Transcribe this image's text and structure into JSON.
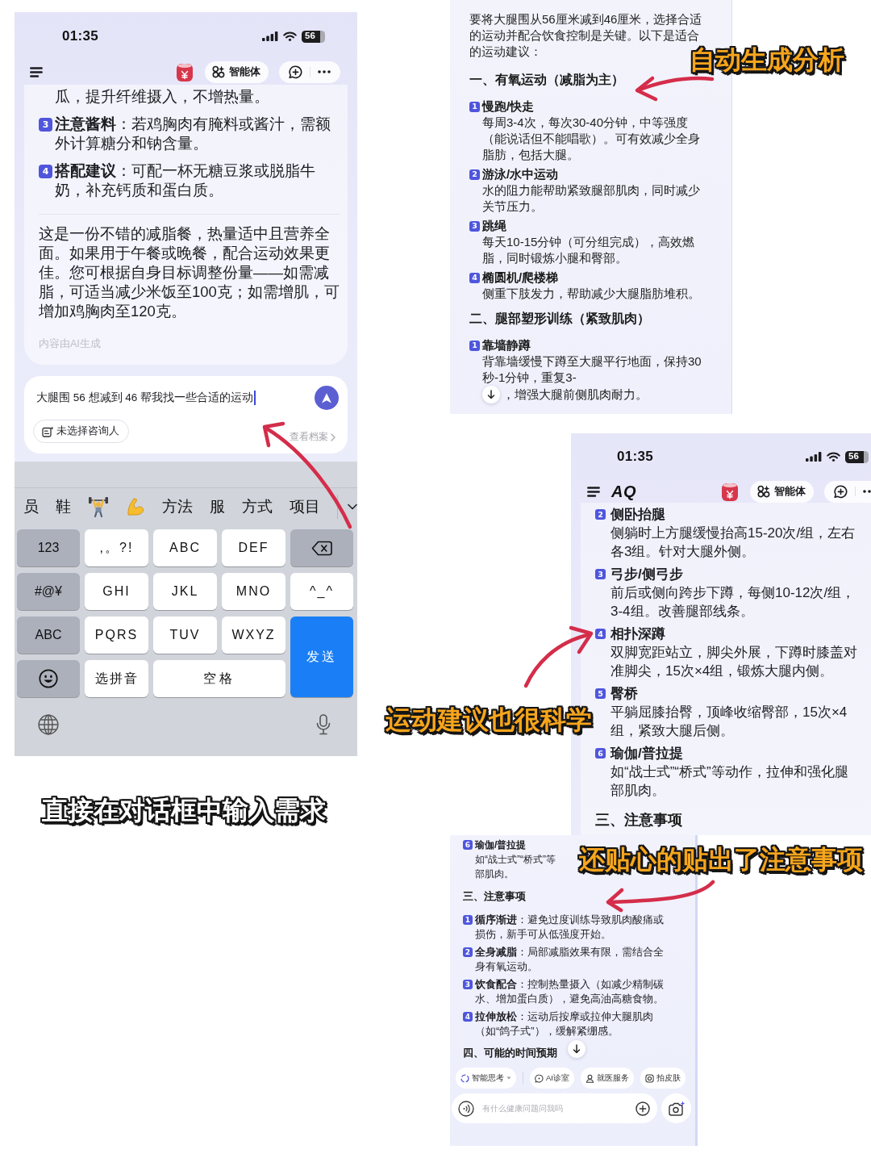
{
  "chat_screen": {
    "status_bar": {
      "time": "01:35",
      "battery": "56"
    },
    "header": {
      "agent_button": "智能体"
    },
    "reply": {
      "continuation": "瓜，提升纤维摄入，不增热量。",
      "items": [
        {
          "number": "3",
          "text": "**注意酱料**：若鸡胸肉有腌料或酱汁，需额外计算糖分和钠含量。"
        },
        {
          "number": "4",
          "text": "**搭配建议**：可配一杯无糖豆浆或脱脂牛奶，补充钙质和蛋白质。"
        }
      ],
      "summary": "这是一份不错的减脂餐，热量适中且营养全面。如果用于午餐或晚餐，配合运动效果更佳。您可根据自身目标调整份量——如需减脂，可适当减少米饭至100克；如需增肌，可增加鸡胸肉至120克。",
      "disclaimer": "内容由AI生成"
    },
    "composer": {
      "value": "大腿围 56 想减到 46 帮我找一些合适的运动",
      "consultant_button": "未选择咨询人",
      "records_link": "查看档案"
    },
    "keyboard": {
      "candidates": [
        {
          "kind": "word",
          "text": "员"
        },
        {
          "kind": "word",
          "text": "鞋"
        },
        {
          "kind": "lifter"
        },
        {
          "kind": "flex"
        },
        {
          "kind": "word",
          "text": "方法"
        },
        {
          "kind": "word",
          "text": "服"
        },
        {
          "kind": "word",
          "text": "方式"
        },
        {
          "kind": "word",
          "text": "项目"
        }
      ],
      "keys": [
        {
          "kind": "function",
          "label": "123"
        },
        {
          "kind": "letter",
          "label": ",。?!"
        },
        {
          "kind": "letter",
          "label": "ABC"
        },
        {
          "kind": "letter",
          "label": "DEF"
        },
        {
          "kind": "delete"
        },
        {
          "kind": "function",
          "label": "#@¥"
        },
        {
          "kind": "letter",
          "label": "GHI"
        },
        {
          "kind": "letter",
          "label": "JKL"
        },
        {
          "kind": "letter",
          "label": "MNO"
        },
        {
          "kind": "letter",
          "label": "^_^"
        },
        {
          "kind": "function",
          "label": "ABC"
        },
        {
          "kind": "letter",
          "label": "PQRS"
        },
        {
          "kind": "letter",
          "label": "TUV"
        },
        {
          "kind": "letter",
          "label": "WXYZ"
        },
        {
          "kind": "send",
          "label": "发送"
        },
        {
          "kind": "emoji"
        },
        {
          "kind": "letter",
          "label": "选拼音"
        },
        {
          "kind": "space",
          "label": "空格"
        }
      ]
    },
    "caption": {
      "kind": "plain",
      "text": "直接在对话框中输入需求"
    }
  },
  "analysis_screen": {
    "intro": "要将大腿围从56厘米减到46厘米，选择合适的运动并配合饮食控制是关键。以下是适合的运动建议：",
    "sections": [
      {
        "heading": "一、有氧运动（减脂为主）",
        "items": [
          {
            "number": "1",
            "title": "慢跑/快走",
            "text": "每周3-4次，每次30-40分钟，中等强度（能说话但不能唱歌）。可有效减少全身脂肪，包括大腿。"
          },
          {
            "number": "2",
            "title": "游泳/水中运动",
            "text": "水的阻力能帮助紧致腿部肌肉，同时减少关节压力。"
          },
          {
            "number": "3",
            "title": "跳绳",
            "text": "每天10-15分钟（可分组完成），高效燃脂，同时锻炼小腿和臀部。"
          },
          {
            "number": "4",
            "title": "椭圆机/爬楼梯",
            "text": "侧重下肢发力，帮助减少大腿脂肪堆积。"
          }
        ]
      },
      {
        "heading": "二、腿部塑形训练（紧致肌肉）",
        "items": [
          {
            "number": "1",
            "title": "靠墙静蹲",
            "text": "背靠墙缓慢下蹲至大腿平行地面，保持30秒-1分钟，重复3-",
            "text_after": "，增强大腿前侧肌肉耐力。"
          }
        ]
      }
    ],
    "caption": {
      "kind": "highlight",
      "text": "自动生成分析"
    }
  },
  "exercise_screen": {
    "status_bar": {
      "time": "01:35",
      "battery": "56"
    },
    "header": {
      "logo": "AQ",
      "agent_button": "智能体"
    },
    "items": [
      {
        "number": "2",
        "title": "侧卧抬腿",
        "text": "侧躺时上方腿缓慢抬高15-20次/组，左右各3组。针对大腿外侧。"
      },
      {
        "number": "3",
        "title": "弓步/侧弓步",
        "text": "前后或侧向跨步下蹲，每侧10-12次/组，3-4组。改善腿部线条。"
      },
      {
        "number": "4",
        "title": "相扑深蹲",
        "text": "双脚宽距站立，脚尖外展，下蹲时膝盖对准脚尖，15次×4组，锻炼大腿内侧。"
      },
      {
        "number": "5",
        "title": "臀桥",
        "text": "平躺屈膝抬臀，顶峰收缩臀部，15次×4组，紧致大腿后侧。"
      },
      {
        "number": "6",
        "title": "瑜伽/普拉提",
        "text": "如“战士式”“桥式”等动作，拉伸和强化腿部肌肉。"
      }
    ],
    "heading": "三、注意事项",
    "caption": {
      "kind": "highlight",
      "text": "运动建议也很科学"
    }
  },
  "precautions_screen": {
    "top_item": {
      "number": "6",
      "title": "瑜伽/普拉提",
      "lines": [
        "如“战士式”“桥式”等",
        "部肌肉。"
      ]
    },
    "heading": "三、注意事项",
    "items": [
      {
        "number": "1",
        "text": "**循序渐进**：避免过度训练导致肌肉酸痛或损伤，新手可从低强度开始。"
      },
      {
        "number": "2",
        "text": "**全身减脂**：局部减脂效果有限，需结合全身有氧运动。"
      },
      {
        "number": "3",
        "text": "**饮食配合**：控制热量摄入（如减少精制碳水、增加蛋白质），避免高油高糖食物。"
      },
      {
        "number": "4",
        "text": "**拉伸放松**：运动后按摩或拉伸大腿肌肉（如“鸽子式”），缓解紧绷感。"
      }
    ],
    "next_heading": "四、可能的时间预期",
    "chips": [
      {
        "kind": "think",
        "label": "智能思考"
      },
      {
        "kind": "clinic",
        "label": "AI诊室"
      },
      {
        "kind": "doctor",
        "label": "就医服务"
      },
      {
        "kind": "skin",
        "label": "拍皮肤"
      }
    ],
    "composer": {
      "placeholder": "有什么健康问题问我吗"
    },
    "caption": {
      "kind": "highlight",
      "text": "还贴心的贴出了注意事项"
    }
  }
}
